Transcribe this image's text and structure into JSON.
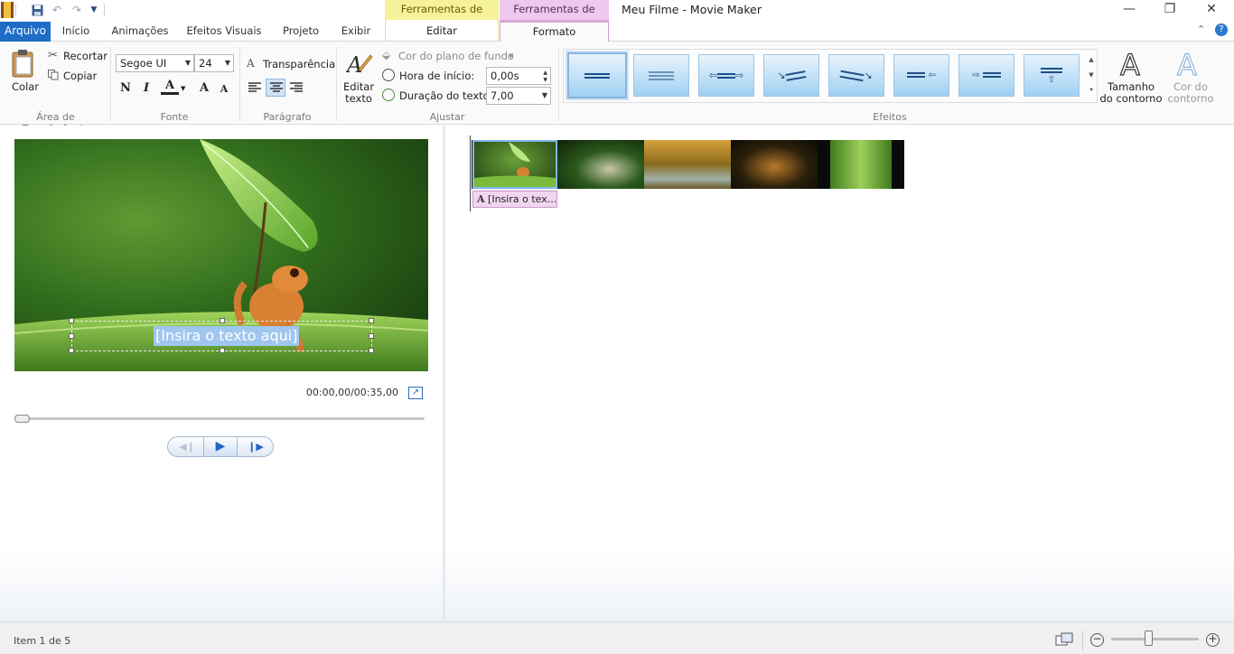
{
  "window": {
    "title": "Meu Filme - Movie Maker",
    "minimize": "—",
    "maximize": "❐",
    "close": "✕"
  },
  "quick_access": {
    "save_icon": "save-icon",
    "undo_icon": "undo-icon",
    "redo_icon": "redo-icon",
    "customize_icon": "customize-icon"
  },
  "context_tabs": {
    "video_group": "Ferramentas de Vídeo",
    "video_tab": "Editar",
    "text_group": "Ferramentas de Texto",
    "text_tab": "Formato"
  },
  "tabs": [
    "Arquivo",
    "Início",
    "Animações",
    "Efeitos Visuais",
    "Projeto",
    "Exibir"
  ],
  "ribbon": {
    "clipboard": {
      "label": "Área de Transferência",
      "paste": "Colar",
      "cut": "Recortar",
      "copy": "Copiar"
    },
    "font": {
      "label": "Fonte",
      "family": "Segoe UI",
      "size": "24",
      "bold": "N",
      "italic": "I",
      "color": "A",
      "grow": "A",
      "shrink": "A"
    },
    "paragraph": {
      "label": "Parágrafo",
      "transparency": "Transparência"
    },
    "adjust": {
      "label": "Ajustar",
      "edit_text": "Editar texto",
      "bg_color": "Cor do plano de fundo",
      "start_time_label": "Hora de início:",
      "start_time": "0,00s",
      "duration_label": "Duração do texto:",
      "duration": "7,00"
    },
    "effects": {
      "label": "Efeitos",
      "outline_size": "Tamanho do contorno",
      "outline_color": "Cor do contorno",
      "selected_index": 0
    }
  },
  "preview": {
    "overlay_text": "[Insira o texto aqui]",
    "time": "00:00,00/00:35,00",
    "seek_fraction": 0.0
  },
  "storyboard": {
    "caption_chip": "[Insira o tex..."
  },
  "statusbar": {
    "item": "Item 1 de 5",
    "zoom_fraction": 0.42
  },
  "colors": {
    "arquivo": "#1e6cc8",
    "video_context": "#f6f29a",
    "text_context": "#eec8ee",
    "selection": "#9fc6ee"
  }
}
